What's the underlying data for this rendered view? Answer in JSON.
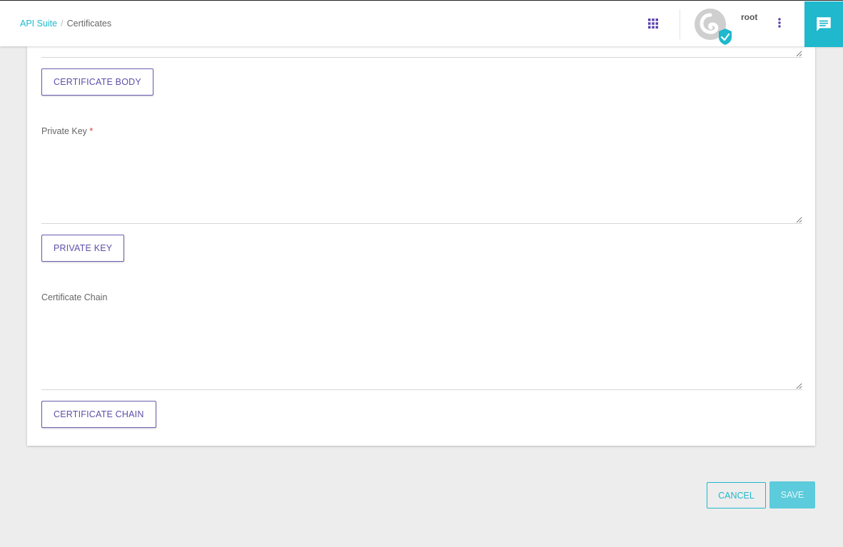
{
  "breadcrumb": {
    "link_label": "API Suite",
    "separator": "/",
    "current_label": "Certificates"
  },
  "header": {
    "apps_icon": "apps-grid-icon",
    "username": "root",
    "more_icon": "more-vertical-icon",
    "chat_icon": "chat-message-icon"
  },
  "form": {
    "certificate_body": {
      "value": "",
      "upload_label": "CERTIFICATE BODY"
    },
    "private_key": {
      "label": "Private Key",
      "required_mark": "*",
      "value": "",
      "upload_label": "PRIVATE KEY"
    },
    "certificate_chain": {
      "label": "Certificate Chain",
      "value": "",
      "upload_label": "CERTIFICATE CHAIN"
    }
  },
  "actions": {
    "cancel_label": "CANCEL",
    "save_label": "SAVE"
  },
  "colors": {
    "accent": "#1fb8cc",
    "secondary": "#5b50a6",
    "required": "#e53935",
    "background": "#ededed"
  }
}
